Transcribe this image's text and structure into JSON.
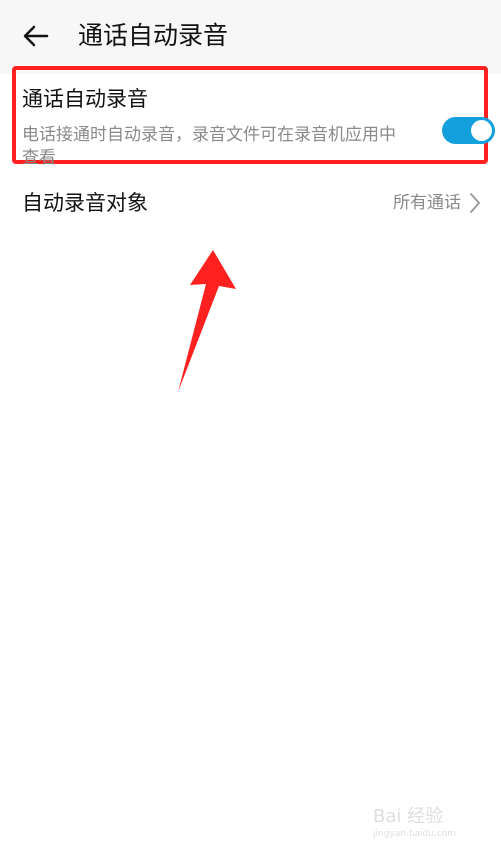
{
  "header": {
    "back_icon": "back-arrow-icon",
    "title": "通话自动录音"
  },
  "settings": {
    "auto_record": {
      "title": "通话自动录音",
      "description": "电话接通时自动录音，录音文件可在录音机应用中查看",
      "enabled": true
    },
    "record_target": {
      "title": "自动录音对象",
      "value": "所有通话",
      "chevron_icon": "chevron-right-icon"
    }
  },
  "colors": {
    "accent": "#14a0dc",
    "highlight": "#ff2020",
    "text_primary": "#111111",
    "text_secondary": "#8a8a8a"
  },
  "watermark": {
    "brand": "Bai 经验",
    "url": "jingyan.baidu.com"
  }
}
